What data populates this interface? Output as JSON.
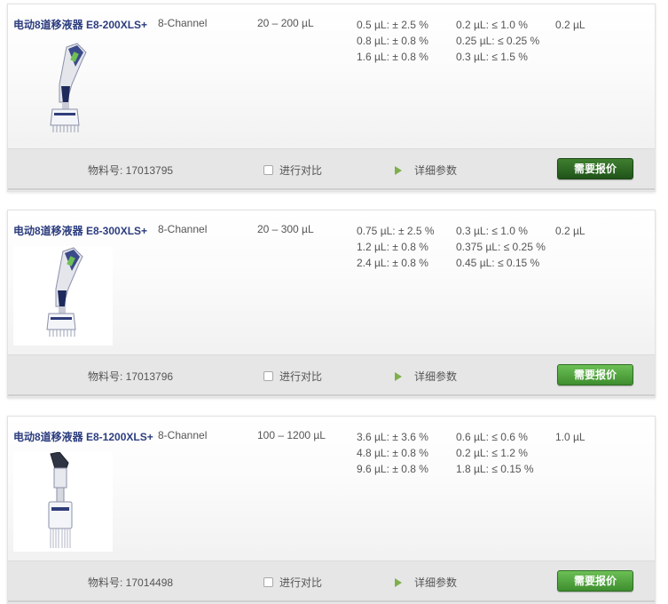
{
  "products": [
    {
      "title": "电动8道移液器 E8-200XLS+",
      "channel": "8-Channel",
      "range": "20 – 200 µL",
      "accuracy": [
        "0.5 µL: ± 2.5 %",
        "0.8 µL: ± 0.8 %",
        "1.6 µL: ± 0.8 %"
      ],
      "precision": [
        "0.2 µL: ≤ 1.0 %",
        "0.25 µL: ≤ 0.25 %",
        "0.3 µL: ≤ 1.5 %"
      ],
      "increment": "0.2 µL",
      "material_no": "物料号: 17013795",
      "compare_label": "进行对比",
      "details_label": "详细参数",
      "quote_label": "需要报价",
      "image_icon": "electronic-pipette-icon"
    },
    {
      "title": "电动8道移液器 E8-300XLS+",
      "channel": "8-Channel",
      "range": "20 – 300 µL",
      "accuracy": [
        "0.75 µL: ± 2.5 %",
        "1.2 µL: ± 0.8 %",
        "2.4 µL: ± 0.8 %"
      ],
      "precision": [
        "0.3 µL: ≤ 1.0 %",
        "0.375 µL: ≤ 0.25 %",
        "0.45 µL: ≤ 0.15 %"
      ],
      "increment": "0.2 µL",
      "material_no": "物料号: 17013796",
      "compare_label": "进行对比",
      "details_label": "详细参数",
      "quote_label": "需要报价",
      "image_icon": "electronic-pipette-icon"
    },
    {
      "title": "电动8道移液器 E8-1200XLS+",
      "channel": "8-Channel",
      "range": "100 – 1200 µL",
      "accuracy": [
        "3.6 µL: ± 3.6 %",
        "4.8 µL: ± 0.8 %",
        "9.6 µL: ± 0.8 %"
      ],
      "precision": [
        "0.6 µL: ≤ 0.6 %",
        "0.2 µL: ≤ 1.2 %",
        "1.8 µL: ≤ 0.15 %"
      ],
      "increment": "1.0 µL",
      "material_no": "物料号: 17014498",
      "compare_label": "进行对比",
      "details_label": "详细参数",
      "quote_label": "需要报价",
      "image_icon": "electronic-pipette-icon"
    }
  ],
  "colors": {
    "title": "#2c3d7f",
    "quote_button": "#4a9a36",
    "details_arrow": "#7db04a"
  }
}
